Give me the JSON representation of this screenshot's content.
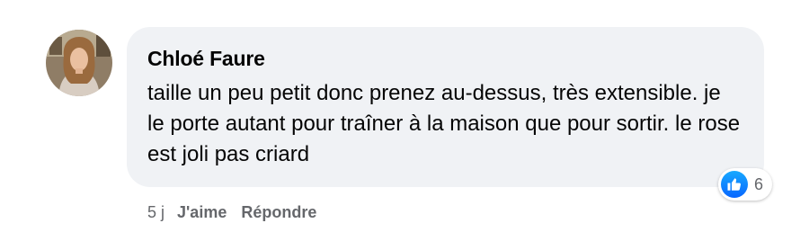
{
  "comment": {
    "author": "Chloé Faure",
    "text": "taille un peu petit donc prenez au-dessus, très extensible. je le porte autant pour traîner à la maison que pour sortir. le rose est joli pas criard",
    "avatar_icon": "profile-photo",
    "reaction": {
      "icon": "like-icon",
      "count": "6"
    },
    "timestamp": "5 j",
    "like_label": "J'aime",
    "reply_label": "Répondre"
  },
  "colors": {
    "bubble_background": "#f0f2f5",
    "meta_text": "#65676b",
    "like_blue": "#0866ff"
  }
}
